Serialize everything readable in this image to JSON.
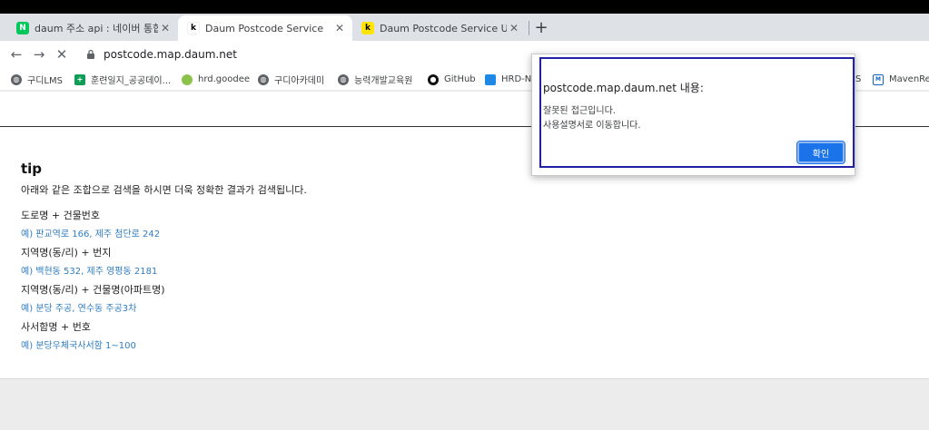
{
  "tabs": [
    {
      "title": "daum 주소 api : 네이버 통합검색",
      "favicon": "N",
      "favicon_color": "#03c75a",
      "active": false
    },
    {
      "title": "Daum Postcode Service",
      "favicon": "k",
      "favicon_color": "#ffffff",
      "active": true
    },
    {
      "title": "Daum Postcode Service User Gu",
      "favicon": "k",
      "favicon_color": "#ffe500",
      "active": false
    }
  ],
  "tab_close": "✕",
  "new_tab": "+",
  "toolbar": {
    "back": "←",
    "forward": "→",
    "stop": "✕",
    "url": "postcode.map.daum.net"
  },
  "bookmarks": [
    {
      "label": "구디LMS",
      "icon": "globe-icon"
    },
    {
      "label": "훈련일지_공공데이...",
      "icon": "sheets-icon"
    },
    {
      "label": "hrd.goodee",
      "icon": "leaf-icon"
    },
    {
      "label": "구디아카데미",
      "icon": "globe-icon"
    },
    {
      "label": "능력개발교육원",
      "icon": "globe-icon"
    },
    {
      "label": "GitHub",
      "icon": "github-icon"
    },
    {
      "label": "HRD-Ne",
      "icon": "hrd-icon"
    },
    {
      "label": "S",
      "icon": ""
    },
    {
      "label": "MavenRep",
      "icon": "maven-icon"
    }
  ],
  "page": {
    "tip_title": "tip",
    "tip_desc": "아래와 같은 조합으로 검색을 하시면 더욱 정확한 결과가 검색됩니다.",
    "examples": [
      {
        "label": "도로명 + 건물번호",
        "example": "예) 판교역로 166,  제주 첨단로 242"
      },
      {
        "label": "지역명(동/리) + 번지",
        "example": "예) 백현동 532,  제주 영평동 2181"
      },
      {
        "label": "지역명(동/리) + 건물명(아파트명)",
        "example": "예) 분당 주공,  연수동 주공3차"
      },
      {
        "label": "사서함명 + 번호",
        "example": "예) 분당우체국사서함 1~100"
      }
    ]
  },
  "dialog": {
    "title": "postcode.map.daum.net 내용:",
    "message_line1": "잘못된 접근입니다.",
    "message_line2": "사용설명서로 이동합니다.",
    "ok_label": "확인"
  },
  "colors": {
    "accent": "#1a73e8",
    "link": "#2f7dc1",
    "focus_border": "#2020a8"
  }
}
